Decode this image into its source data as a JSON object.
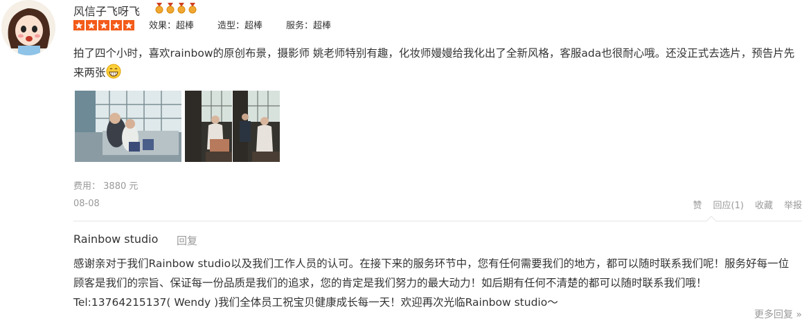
{
  "review": {
    "username": "风信子飞呀飞",
    "medal_count": 4,
    "rating_stars": 5,
    "scores": [
      {
        "label": "效果：超棒"
      },
      {
        "label": "造型：超棒"
      },
      {
        "label": "服务：超棒"
      }
    ],
    "content": "拍了四个小时，喜欢rainbow的原创布景，摄影师 姚老师特别有趣，化妆师嫚嫚给我化出了全新风格，客服ada也很耐心哦。还没正式去选片，预告片先来两张",
    "fee_label": "费用：",
    "fee_value": "3880 元",
    "date": "08-08",
    "actions": {
      "like": "赞",
      "reply": "回应(1)",
      "favorite": "收藏",
      "report": "举报"
    }
  },
  "reply": {
    "name": "Rainbow studio",
    "label": "回复",
    "text": "感谢亲对于我们Rainbow studio以及我们工作人员的认可。在接下来的服务环节中，您有任何需要我们的地方，都可以随时联系我们呢！服务好每一位顾客是我们的宗旨、保证每一份品质是我们的追求，您的肯定是我们努力的最大动力！如后期有任何不清楚的都可以随时联系我们哦！Tel:13764215137( Wendy )我们全体员工祝宝贝健康成长每一天！欢迎再次光临Rainbow studio～"
  },
  "more_replies": "更多回复 »",
  "colors": {
    "star": "#f35b1a",
    "medal": "#e8a020",
    "muted_text": "#999999",
    "text": "#333333"
  }
}
